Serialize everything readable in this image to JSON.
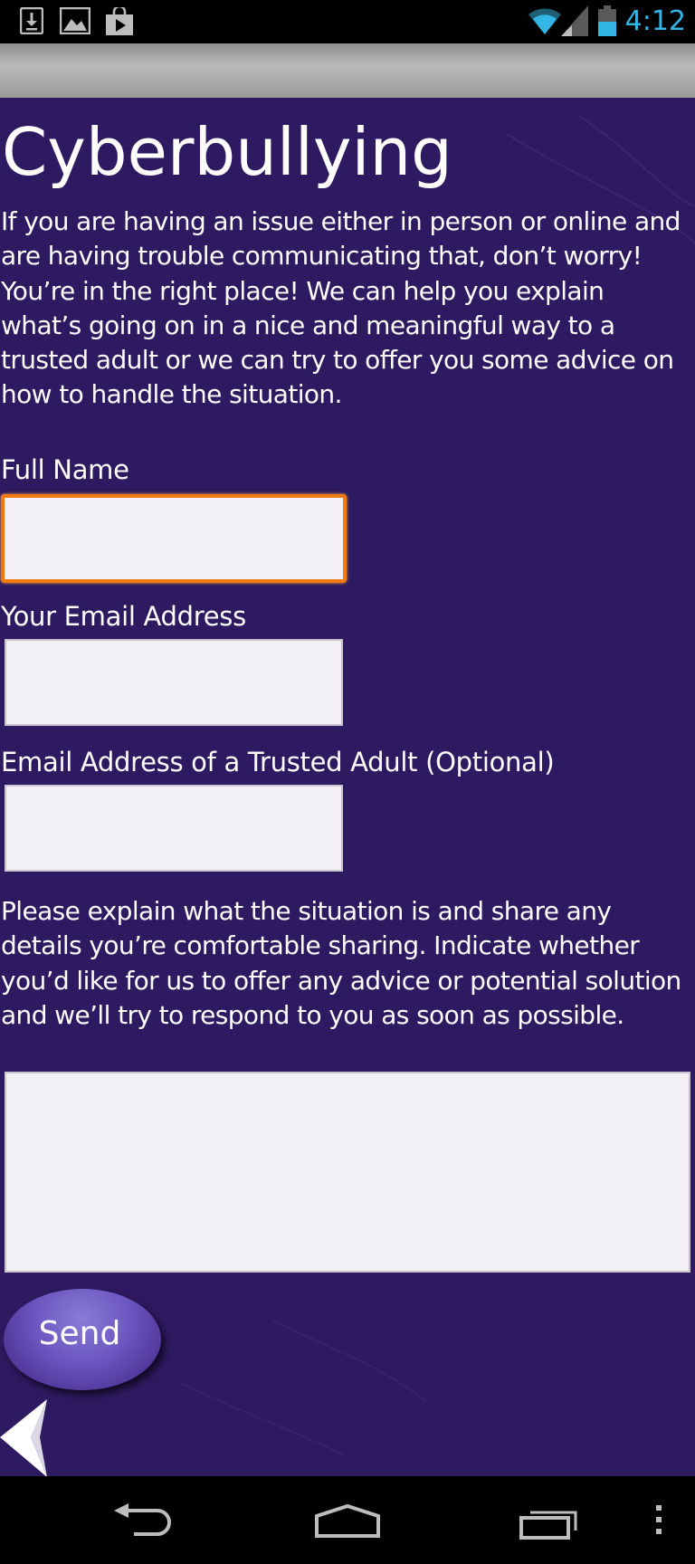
{
  "status_bar": {
    "time": "4:12",
    "accent_color": "#33b5e5",
    "left_icons": [
      "download-icon",
      "image-icon",
      "play-store-icon"
    ],
    "right_icons": [
      "wifi-icon",
      "signal-icon",
      "battery-icon"
    ]
  },
  "page": {
    "title": "Cyberbullying",
    "intro": "If you are having an issue either in person or online and are having trouble communicating that, don’t worry! You’re in the right place! We can help you explain what’s going on in a nice and meaningful way to a trusted adult or we can try to offer you some advice on how to handle the situation.",
    "background_color": "#2e1a60"
  },
  "form": {
    "full_name": {
      "label": "Full Name",
      "value": ""
    },
    "your_email": {
      "label": "Your Email Address",
      "value": ""
    },
    "trusted_email": {
      "label": "Email Address of a Trusted Adult (Optional)",
      "value": ""
    },
    "details": {
      "label": "Please explain what the situation is and share any details you’re comfortable sharing. Indicate whether you’d like for us to offer any advice or potential solution and we’ll try to respond to you as soon as possible.",
      "value": ""
    },
    "send_label": "Send",
    "focus_color": "#f07a10"
  },
  "nav_bar": {
    "buttons": [
      "back-nav-icon",
      "home-nav-icon",
      "recent-apps-icon",
      "overflow-menu-icon"
    ]
  }
}
